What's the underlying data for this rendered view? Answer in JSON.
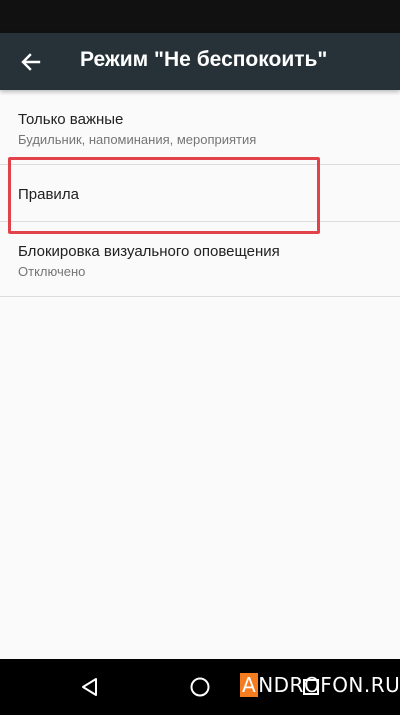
{
  "toolbar": {
    "title": "Режим \"Не беспокоить\"",
    "back_icon": "arrow-back-icon"
  },
  "settings": {
    "items": [
      {
        "title": "Только важные",
        "summary": "Будильник, напоминания, мероприятия"
      },
      {
        "title": "Правила"
      },
      {
        "title": "Блокировка визуального оповещения",
        "summary": "Отключено"
      }
    ]
  },
  "nav_bar": {
    "back_icon": "triangle-back-icon",
    "home_icon": "circle-home-icon",
    "recents_icon": "square-recents-icon"
  },
  "watermark": {
    "first_letter": "A",
    "rest": "NDROFON.RU"
  },
  "colors": {
    "toolbar": "#263238",
    "highlight": "#e2434b",
    "watermark_accent": "#f57c1f"
  }
}
